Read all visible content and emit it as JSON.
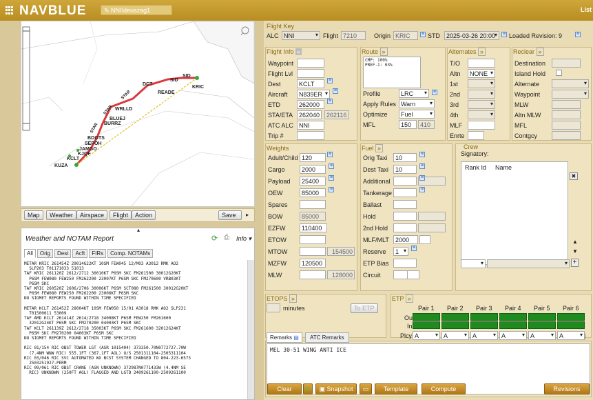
{
  "app": {
    "brand": "NAVBLUE",
    "user": "NNI\\deuszag1",
    "list_link": "List"
  },
  "map": {
    "tools": [
      "Map",
      "Weather",
      "Airspace",
      "Flight",
      "Action"
    ],
    "save": "Save",
    "labels": [
      "DCT",
      "SID",
      "SID",
      "STAR",
      "STAR",
      "STAR",
      "READE",
      "KRIC",
      "WRLLD",
      "BLUEJ",
      "BURRZ",
      "BOOTS",
      "SEPOH",
      "JAMGO",
      "KJQF",
      "KCLT",
      "KUZA"
    ]
  },
  "wx": {
    "title": "Weather and NOTAM Report",
    "info": "Info",
    "tabs": [
      "All",
      "Orig",
      "Dest",
      "Acft",
      "FIRs",
      "Comp. NOTAMs"
    ],
    "text": "METAR KRIC 261454Z 29014G22KT 10SM FEW045 12/M03 A3012 RMK AO2\n  SLP203 T01171033 51013\nTAF KRIC 261120Z 2612/2712 30010KT P6SM SKC FM261500 30012G20KT\n  P6SM FEW080 FEW250 FM262200 23007KT P6SM SKC FM270600 VRB03KT\n  P6SM SKC\nTAF KRIC 260520Z 2606/2706 30006KT P6SM SCT080 FM261500 30012G20KT\n  P6SM FEW080 FEW250 FM262200 23006KT P6SM SKC\nNO SIGMET REPORTS FOUND WITHIN TIME SPECIFIED\n\nMETAR KCLT 261452Z 28004KT 10SM FEW050 15/01 A3018 RMK AO2 SLP231\n  T01500011 53009\nTAF AMD KCLT 261414Z 2614/2718 34008KT P6SM FEW250 FM261600\n  32012G24KT P6SM SKC FM270200 04003KT P6SM SKC\nTAF KCLT 261139Z 2612/2718 35003KT P6SM SKC FM261600 32012G24KT\n  P6SM SKC FM270200 04003KT P6SM SKC\nNO SIGMET REPORTS FOUND WITHIN TIME SPECIFIED\n\nRIC 01/154 RIC OBST TOWER LGT (ASR 1015404) 373350.70N0772727.70W\n  (7.4NM WNW RIC) 555.1FT (367.1FT AGL) U/S 2501311104-2505311104\nRIC 03/046 RIC SVC AUTOMATED WX BCST SYSTEM CHANGED TO 804-223-6573\n  2503251927-PERM\nRIC 09/061 RIC OBST CRANE (ASN UNKNOWN) 372987N0771433W (4.4NM SE\n  RIC) UNKNOWN (250FT AGL) FLAGGED AND LGTD 2409261100-2509261100"
  },
  "flight_key": {
    "title": "Flight Key",
    "alc_label": "ALC",
    "alc": "NNI",
    "flight_label": "Flight",
    "flight": "7210",
    "origin_label": "Origin",
    "origin": "KRIC",
    "std_label": "STD",
    "std": "2025-03-26 20:00",
    "loaded": "Loaded Revision: 9"
  },
  "flight_info": {
    "title": "Flight Info",
    "rows": [
      {
        "label": "Waypoint",
        "value": ""
      },
      {
        "label": "Flight Lvl",
        "value": ""
      },
      {
        "label": "Dest",
        "value": "KCLT"
      },
      {
        "label": "Aircraft",
        "value": "N839ER"
      },
      {
        "label": "ETD",
        "value": "262000"
      },
      {
        "label": "STA/ETA",
        "value": "262040",
        "value2": "262116"
      },
      {
        "label": "ATC ALC",
        "value": "NNI"
      },
      {
        "label": "Trip #",
        "value": ""
      }
    ]
  },
  "route": {
    "title": "Route",
    "lines": "CMP: 100%\nPREF-1: 03%",
    "profile_label": "Profile",
    "profile": "LRC",
    "apply_label": "Apply Rules",
    "apply": "Warn",
    "optimize_label": "Optimize",
    "optimize": "Fuel",
    "mfl_label": "MFL",
    "mfl": "150",
    "mfl2": "410"
  },
  "alternates": {
    "title": "Alternates",
    "rows": [
      "T/O",
      "Altn",
      "1st",
      "2nd",
      "3rd",
      "4th",
      "MLF",
      "Enrte"
    ],
    "altn_value": "NONE"
  },
  "reclear": {
    "title": "Reclear",
    "rows": [
      "Destination",
      "Island Hold",
      "Alternate",
      "Waypoint",
      "MLW",
      "Altn MLW",
      "MFL",
      "Contgcy"
    ]
  },
  "weights": {
    "title": "Weights",
    "rows": [
      {
        "label": "Adult/Child",
        "value": "120"
      },
      {
        "label": "Cargo",
        "value": "2000"
      },
      {
        "label": "Payload",
        "value": "25400"
      },
      {
        "label": "OEW",
        "value": "85000"
      },
      {
        "label": "Spares",
        "value": ""
      },
      {
        "label": "BOW",
        "value": "85000"
      },
      {
        "label": "EZFW",
        "value": "110400"
      },
      {
        "label": "ETOW",
        "value": ""
      },
      {
        "label": "MTOW",
        "value": "",
        "value2": "154500"
      },
      {
        "label": "MZFW",
        "value": "120500"
      },
      {
        "label": "MLW",
        "value": "",
        "value2": "128000"
      }
    ]
  },
  "fuel": {
    "title": "Fuel",
    "rows": [
      {
        "label": "Orig Taxi",
        "value": "10"
      },
      {
        "label": "Dest Taxi",
        "value": "10"
      },
      {
        "label": "Additional",
        "value": ""
      },
      {
        "label": "Tankerage",
        "value": ""
      },
      {
        "label": "Ballast",
        "value": ""
      },
      {
        "label": "Hold",
        "value": ""
      },
      {
        "label": "2nd Hold",
        "value": ""
      },
      {
        "label": "MLF/MLT",
        "value": "2000"
      },
      {
        "label": "Reserve",
        "value": "1"
      },
      {
        "label": "ETP Bias",
        "value": ""
      },
      {
        "label": "Circuit",
        "value": ""
      }
    ]
  },
  "crew": {
    "title": "Crew",
    "signatory": "Signatory:",
    "col1": "Rank Id",
    "col2": "Name"
  },
  "etops": {
    "title": "ETOPS",
    "minutes": "minutes",
    "to_etp": "To ETP"
  },
  "etp": {
    "title": "ETP",
    "pairs": [
      "Pair 1",
      "Pair 2",
      "Pair 3",
      "Pair 4",
      "Pair 5",
      "Pair 6"
    ],
    "out": "Out",
    "in": "In",
    "plcy": "Plcy",
    "plcy_val": "A"
  },
  "remarks": {
    "tabs": [
      "Remarks",
      "ATC Remarks"
    ],
    "text": "MEL 30-51 WING ANTI ICE"
  },
  "actions": {
    "clear": "Clear",
    "snapshot": "Snapshot",
    "template": "Template",
    "compute": "Compute",
    "revisions": "Revisions"
  }
}
